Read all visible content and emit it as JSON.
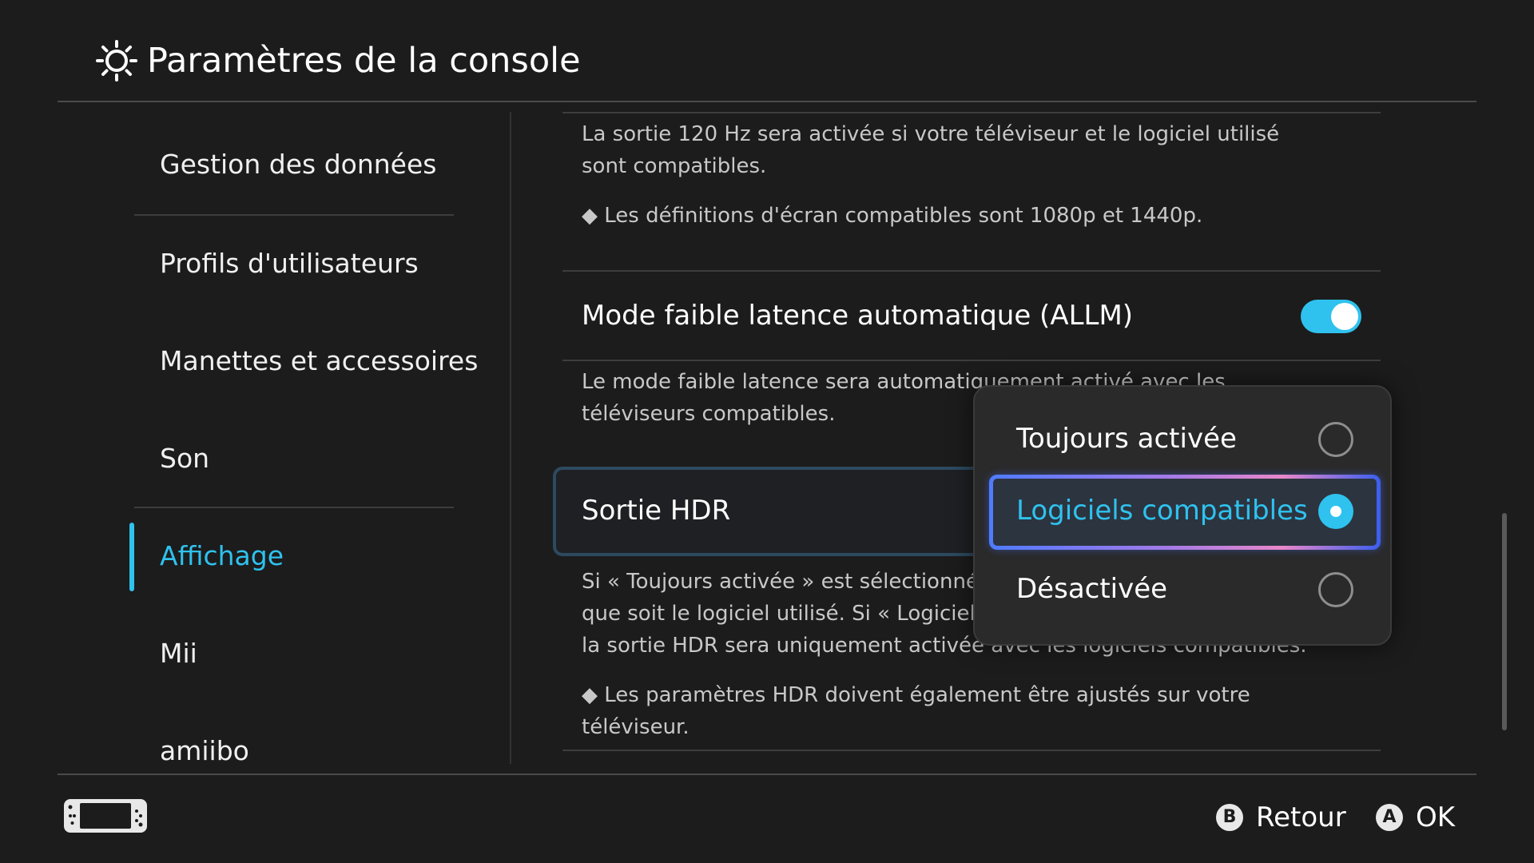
{
  "header": {
    "title": "Paramètres de la console",
    "icon": "gear-icon"
  },
  "sidebar": {
    "items": [
      {
        "label": "Gestion des données"
      },
      {
        "label": "Profils d'utilisateurs"
      },
      {
        "label": "Manettes et accessoires"
      },
      {
        "label": "Son"
      },
      {
        "label": "Affichage",
        "active": true
      },
      {
        "label": "Mii"
      },
      {
        "label": "amiibo"
      }
    ]
  },
  "content": {
    "hz_desc": "La sortie 120 Hz sera activée si votre téléviseur et le logiciel utilisé sont compatibles.",
    "hz_note": "◆ Les définitions d'écran compatibles sont 1080p et 1440p.",
    "allm": {
      "label": "Mode faible latence automatique (ALLM)",
      "enabled": true,
      "desc": "Le mode faible latence sera automatiquement activé avec les téléviseurs compatibles."
    },
    "hdr": {
      "label": "Sortie HDR",
      "desc": "Si « Toujours activée » est sélectionné, la sortie HDR sera activée quel que soit le logiciel utilisé. Si « Logiciels compatibles » est sélectionné, la sortie HDR sera uniquement activée avec les logiciels compatibles.",
      "note": "◆ Les paramètres HDR doivent également être ajustés sur votre téléviseur."
    }
  },
  "popup": {
    "options": [
      {
        "label": "Toujours activée",
        "selected": false
      },
      {
        "label": "Logiciels compatibles",
        "selected": true
      },
      {
        "label": "Désactivée",
        "selected": false
      }
    ]
  },
  "footer": {
    "back": {
      "button": "B",
      "label": "Retour"
    },
    "ok": {
      "button": "A",
      "label": "OK"
    }
  },
  "colors": {
    "accent": "#2fc2ee",
    "background": "#1c1c1c"
  }
}
